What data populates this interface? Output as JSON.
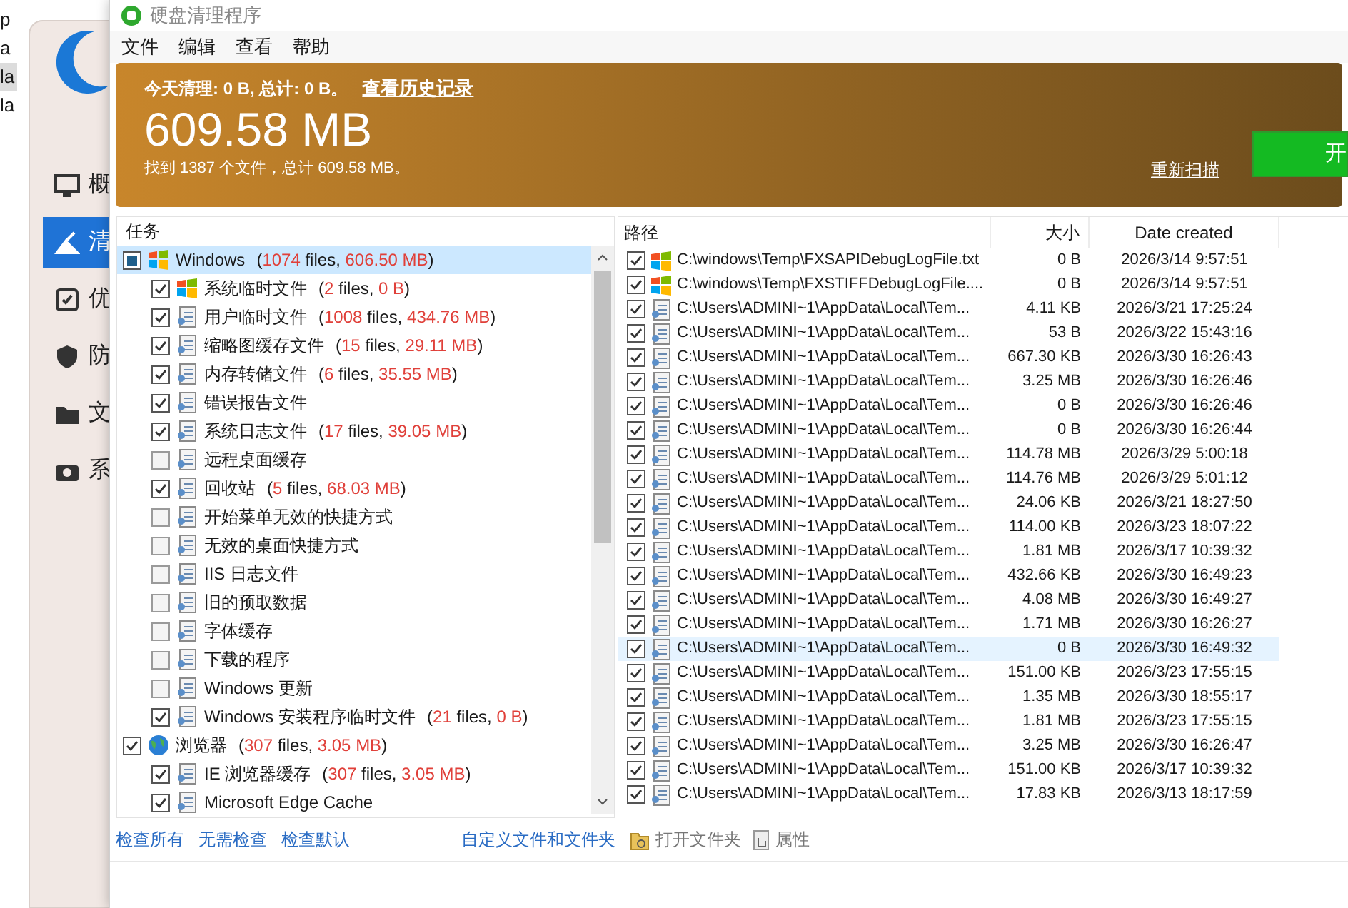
{
  "background_window": {
    "edge_texts": [
      {
        "text": "p",
        "selected": false
      },
      {
        "text": "a",
        "selected": false
      },
      {
        "text": "la",
        "selected": true
      },
      {
        "text": "la",
        "selected": false
      }
    ],
    "sidebar": [
      {
        "label": "概",
        "selected": false
      },
      {
        "label": "清",
        "selected": true
      },
      {
        "label": "优",
        "selected": false
      },
      {
        "label": "防",
        "selected": false
      },
      {
        "label": "文",
        "selected": false
      },
      {
        "label": "系",
        "selected": false
      }
    ]
  },
  "window": {
    "title": "硬盘清理程序"
  },
  "menu": [
    "文件",
    "编辑",
    "查看",
    "帮助"
  ],
  "banner": {
    "summary": "今天清理: 0 B, 总计: 0 B。",
    "history_link": "查看历史记录",
    "total": "609.58 MB",
    "found": "找到 1387 个文件，总计 609.58 MB。",
    "rescan_link": "重新扫描",
    "start_button": "开"
  },
  "tasks": {
    "header": "任务",
    "items": [
      {
        "label": "Windows",
        "kind": "windows",
        "checked": true,
        "indeterminate": true,
        "selected": true,
        "stats": [
          "(",
          "1074",
          " files, ",
          "606.50 MB",
          ")"
        ],
        "children": [
          {
            "label": "系统临时文件",
            "checked": true,
            "stats": [
              "(",
              "2",
              " files, ",
              "0 B",
              ")"
            ]
          },
          {
            "label": "用户临时文件",
            "checked": true,
            "stats": [
              "(",
              "1008",
              " files, ",
              "434.76 MB",
              ")"
            ]
          },
          {
            "label": "缩略图缓存文件",
            "checked": true,
            "stats": [
              "(",
              "15",
              " files, ",
              "29.11 MB",
              ")"
            ]
          },
          {
            "label": "内存转储文件",
            "checked": true,
            "stats": [
              "(",
              "6",
              " files, ",
              "35.55 MB",
              ")"
            ]
          },
          {
            "label": "错误报告文件",
            "checked": true
          },
          {
            "label": "系统日志文件",
            "checked": true,
            "stats": [
              "(",
              "17",
              " files, ",
              "39.05 MB",
              ")"
            ]
          },
          {
            "label": "远程桌面缓存",
            "checked": false
          },
          {
            "label": "回收站",
            "checked": true,
            "stats": [
              "(",
              "5",
              " files, ",
              "68.03 MB",
              ")"
            ]
          },
          {
            "label": "开始菜单无效的快捷方式",
            "checked": false
          },
          {
            "label": "无效的桌面快捷方式",
            "checked": false
          },
          {
            "label": "IIS 日志文件",
            "checked": false
          },
          {
            "label": "旧的预取数据",
            "checked": false
          },
          {
            "label": "字体缓存",
            "checked": false
          },
          {
            "label": "下载的程序",
            "checked": false
          },
          {
            "label": "Windows 更新",
            "checked": false
          },
          {
            "label": "Windows 安装程序临时文件",
            "checked": true,
            "stats": [
              "(",
              "21",
              " files, ",
              "0 B",
              ")"
            ]
          }
        ]
      },
      {
        "label": "浏览器",
        "kind": "browser",
        "checked": true,
        "indeterminate": false,
        "selected": false,
        "stats": [
          "(",
          "307",
          " files, ",
          "3.05 MB",
          ")"
        ],
        "children": [
          {
            "label": "IE 浏览器缓存",
            "checked": true,
            "stats": [
              "(",
              "307",
              " files, ",
              "3.05 MB",
              ")"
            ]
          },
          {
            "label": "Microsoft Edge Cache",
            "checked": true
          }
        ]
      }
    ]
  },
  "files": {
    "columns": [
      "路径",
      "大小",
      "Date created"
    ],
    "rows": [
      {
        "path": "C:\\windows\\Temp\\FXSAPIDebugLogFile.txt",
        "size": "0 B",
        "date": "2026/3/14 9:57:51",
        "kind": "system",
        "checked": true,
        "selected": false
      },
      {
        "path": "C:\\windows\\Temp\\FXSTIFFDebugLogFile....",
        "size": "0 B",
        "date": "2026/3/14 9:57:51",
        "kind": "system",
        "checked": true,
        "selected": false
      },
      {
        "path": "C:\\Users\\ADMINI~1\\AppData\\Local\\Tem...",
        "size": "4.11 KB",
        "date": "2026/3/21 17:25:24",
        "kind": "user",
        "checked": true,
        "selected": false
      },
      {
        "path": "C:\\Users\\ADMINI~1\\AppData\\Local\\Tem...",
        "size": "53 B",
        "date": "2026/3/22 15:43:16",
        "kind": "user",
        "checked": true,
        "selected": false
      },
      {
        "path": "C:\\Users\\ADMINI~1\\AppData\\Local\\Tem...",
        "size": "667.30 KB",
        "date": "2026/3/30 16:26:43",
        "kind": "user",
        "checked": true,
        "selected": false
      },
      {
        "path": "C:\\Users\\ADMINI~1\\AppData\\Local\\Tem...",
        "size": "3.25 MB",
        "date": "2026/3/30 16:26:46",
        "kind": "user",
        "checked": true,
        "selected": false
      },
      {
        "path": "C:\\Users\\ADMINI~1\\AppData\\Local\\Tem...",
        "size": "0 B",
        "date": "2026/3/30 16:26:46",
        "kind": "user",
        "checked": true,
        "selected": false
      },
      {
        "path": "C:\\Users\\ADMINI~1\\AppData\\Local\\Tem...",
        "size": "0 B",
        "date": "2026/3/30 16:26:44",
        "kind": "user",
        "checked": true,
        "selected": false
      },
      {
        "path": "C:\\Users\\ADMINI~1\\AppData\\Local\\Tem...",
        "size": "114.78 MB",
        "date": "2026/3/29 5:00:18",
        "kind": "user",
        "checked": true,
        "selected": false
      },
      {
        "path": "C:\\Users\\ADMINI~1\\AppData\\Local\\Tem...",
        "size": "114.76 MB",
        "date": "2026/3/29 5:01:12",
        "kind": "user",
        "checked": true,
        "selected": false
      },
      {
        "path": "C:\\Users\\ADMINI~1\\AppData\\Local\\Tem...",
        "size": "24.06 KB",
        "date": "2026/3/21 18:27:50",
        "kind": "user",
        "checked": true,
        "selected": false
      },
      {
        "path": "C:\\Users\\ADMINI~1\\AppData\\Local\\Tem...",
        "size": "114.00 KB",
        "date": "2026/3/23 18:07:22",
        "kind": "user",
        "checked": true,
        "selected": false
      },
      {
        "path": "C:\\Users\\ADMINI~1\\AppData\\Local\\Tem...",
        "size": "1.81 MB",
        "date": "2026/3/17 10:39:32",
        "kind": "user",
        "checked": true,
        "selected": false
      },
      {
        "path": "C:\\Users\\ADMINI~1\\AppData\\Local\\Tem...",
        "size": "432.66 KB",
        "date": "2026/3/30 16:49:23",
        "kind": "user",
        "checked": true,
        "selected": false
      },
      {
        "path": "C:\\Users\\ADMINI~1\\AppData\\Local\\Tem...",
        "size": "4.08 MB",
        "date": "2026/3/30 16:49:27",
        "kind": "user",
        "checked": true,
        "selected": false
      },
      {
        "path": "C:\\Users\\ADMINI~1\\AppData\\Local\\Tem...",
        "size": "1.71 MB",
        "date": "2026/3/30 16:26:27",
        "kind": "user",
        "checked": true,
        "selected": false
      },
      {
        "path": "C:\\Users\\ADMINI~1\\AppData\\Local\\Tem...",
        "size": "0 B",
        "date": "2026/3/30 16:49:32",
        "kind": "user",
        "checked": true,
        "selected": true
      },
      {
        "path": "C:\\Users\\ADMINI~1\\AppData\\Local\\Tem...",
        "size": "151.00 KB",
        "date": "2026/3/23 17:55:15",
        "kind": "user",
        "checked": true,
        "selected": false
      },
      {
        "path": "C:\\Users\\ADMINI~1\\AppData\\Local\\Tem...",
        "size": "1.35 MB",
        "date": "2026/3/30 18:55:17",
        "kind": "user",
        "checked": true,
        "selected": false
      },
      {
        "path": "C:\\Users\\ADMINI~1\\AppData\\Local\\Tem...",
        "size": "1.81 MB",
        "date": "2026/3/23 17:55:15",
        "kind": "user",
        "checked": true,
        "selected": false
      },
      {
        "path": "C:\\Users\\ADMINI~1\\AppData\\Local\\Tem...",
        "size": "3.25 MB",
        "date": "2026/3/30 16:26:47",
        "kind": "user",
        "checked": true,
        "selected": false
      },
      {
        "path": "C:\\Users\\ADMINI~1\\AppData\\Local\\Tem...",
        "size": "151.00 KB",
        "date": "2026/3/17 10:39:32",
        "kind": "user",
        "checked": true,
        "selected": false
      },
      {
        "path": "C:\\Users\\ADMINI~1\\AppData\\Local\\Tem...",
        "size": "17.83 KB",
        "date": "2026/3/13 18:17:59",
        "kind": "user",
        "checked": true,
        "selected": false
      }
    ]
  },
  "task_links": [
    "检查所有",
    "无需检查",
    "检查默认"
  ],
  "file_links": {
    "custom": "自定义文件和文件夹",
    "open_folder": "打开文件夹",
    "properties": "属性"
  }
}
